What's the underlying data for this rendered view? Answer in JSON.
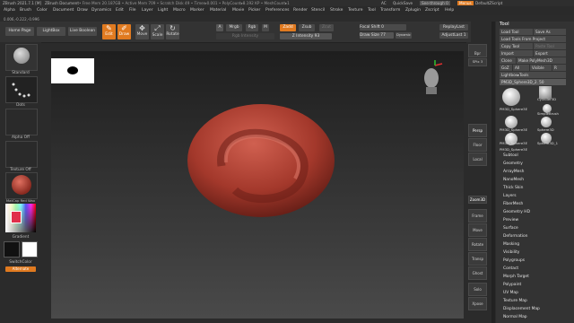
{
  "title": {
    "app": "ZBrush 2021.7.1 [M]",
    "doc": "ZBrush Document",
    "mem": "• Free Mem 20.187GB • Active Mem 709 • Scratch Disk 49 • Timer▸0.001 • PolyCount▸8.192 KP • MeshCount▸1",
    "ac": "AC",
    "quicksave": "QuickSave",
    "seethrough": "See-through 0",
    "menus": "Menus",
    "script": "DefaultZScript"
  },
  "menu": [
    "Alpha",
    "Brush",
    "Color",
    "Document",
    "Draw",
    "Dynamics",
    "Edit",
    "File",
    "Layer",
    "Light",
    "Macro",
    "Marker",
    "Material",
    "Movie",
    "Picker",
    "Preferences",
    "Render",
    "Stencil",
    "Stroke",
    "Texture",
    "Tool",
    "Transform",
    "Zplugin",
    "Zscript",
    "Help"
  ],
  "coords": "0.006,-0.222,-0.996",
  "topbar": {
    "home": "Home Page",
    "lightbox": "LightBox",
    "boolean": "Live Boolean",
    "edit": "Edit",
    "draw": "Draw",
    "move": "Move",
    "scale": "Scale",
    "rotate": "Rotate",
    "a": "A",
    "mrgb": "Mrgb",
    "rgb": "Rgb",
    "m": "M",
    "zadd": "Zadd",
    "zsub": "Zsub",
    "zcut": "Zcut",
    "rgbint": "Rgb Intensity",
    "zint": "Z Intensity 93",
    "focal": "Focal Shift 0",
    "drawsize": "Draw Size 77",
    "dynamic": "Dynamic",
    "replaylast": "ReplayLast",
    "adjustlast": "AdjustLast 1"
  },
  "left": {
    "brush": "Standard",
    "stroke": "Dots",
    "alpha": "Alpha Off",
    "texture": "Texture Off",
    "material": "MatCap Red Wax",
    "gradient": "Gradient",
    "switch": "SwitchColor",
    "alternate": "Alternate"
  },
  "right": [
    "Bpr",
    "SPix 3",
    "Persp",
    "Floor",
    "Local",
    "Frame",
    "Move",
    "Zoom3D",
    "Rotate",
    "Transp",
    "Ghost",
    "Solo",
    "Xpose"
  ],
  "tool": {
    "header": "Tool",
    "load": "Load Tool",
    "saveas": "Save As",
    "loadproj": "Load Tools From Project",
    "copy": "Copy Tool",
    "paste": "Paste Tool",
    "import": "Import",
    "export": "Export",
    "clone": "Clone",
    "makepoly": "Make PolyMesh3D",
    "goz": "GoZ",
    "all": "All",
    "visible": "Visible",
    "r": "R",
    "lightbox": "Lightbox▸Tools",
    "current": "PM3D_Sphere3D_2. 50",
    "t1": "PM3D_Sphere3E",
    "t2": "Cylinder3D",
    "t3": "SimpleBrush",
    "t4": "PM3D_Sphere3E",
    "t5": "Sphere3D",
    "t6": "PM3D_Sphere3E",
    "t7": "Sphere3D_1",
    "t8": "PM3D_Sphere3E"
  },
  "subpalettes": [
    "Subtool",
    "Geometry",
    "ArrayMesh",
    "NanoMesh",
    "Thick Skin",
    "Layers",
    "FiberMesh",
    "Geometry HD",
    "Preview",
    "Surface",
    "Deformation",
    "Masking",
    "Visibility",
    "Polygroups",
    "Contact",
    "Morph Target",
    "Polypaint",
    "UV Map",
    "Texture Map",
    "Displacement Map",
    "Normal Map"
  ],
  "colors": {
    "accent": "#e07a20",
    "clay": "#a3382b"
  }
}
